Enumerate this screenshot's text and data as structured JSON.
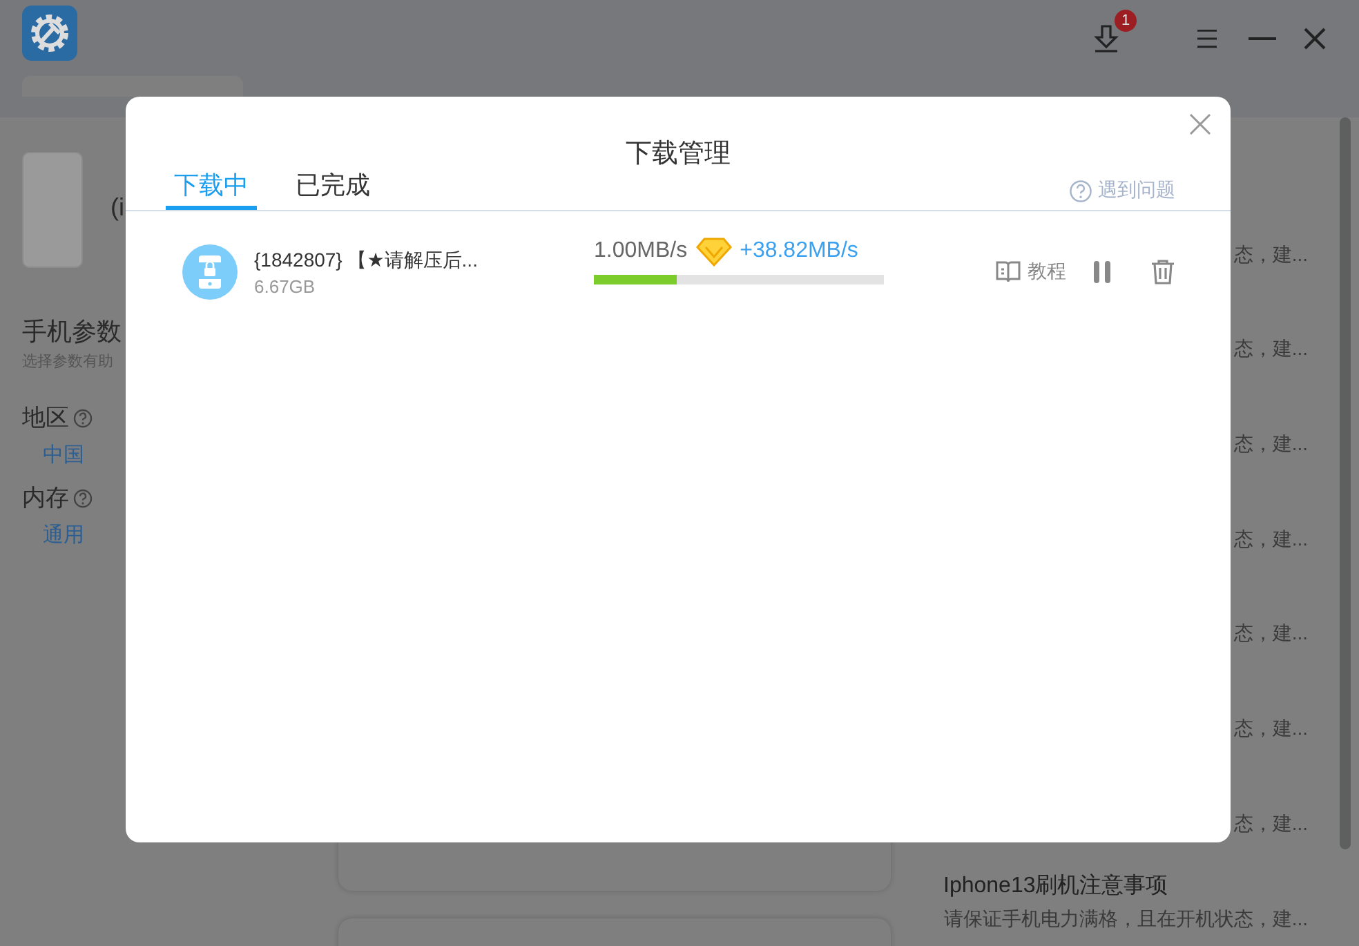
{
  "app": {
    "toolbar": {
      "download_badge": "1"
    },
    "device": {
      "model_fragment": "(i"
    },
    "params": {
      "title": "手机参数",
      "hint": "选择参数有助",
      "settings": [
        {
          "label": "地区",
          "value": "中国"
        },
        {
          "label": "内存",
          "value": "通用"
        }
      ]
    },
    "articles": [
      {
        "desc": "态，建..."
      },
      {
        "desc": "态，建..."
      },
      {
        "desc": "态，建..."
      },
      {
        "desc": "态，建..."
      },
      {
        "desc": "态，建..."
      },
      {
        "desc": "态，建..."
      },
      {
        "desc": "态，建..."
      },
      {
        "title": "Iphone13刷机注意事项",
        "desc": "请保证手机电力满格，且在开机状态，建..."
      }
    ]
  },
  "dialog": {
    "title": "下载管理",
    "tabs": [
      {
        "label": "下载中",
        "selected": true
      },
      {
        "label": "已完成",
        "selected": false
      }
    ],
    "help_link": "遇到问题",
    "downloads": [
      {
        "name": "{1842807} 【★请解压后...",
        "size": "6.67GB",
        "speed": "1.00MB/s",
        "boost": "+38.82MB/s",
        "level": 0.286,
        "tutorial": "教程"
      }
    ]
  }
}
